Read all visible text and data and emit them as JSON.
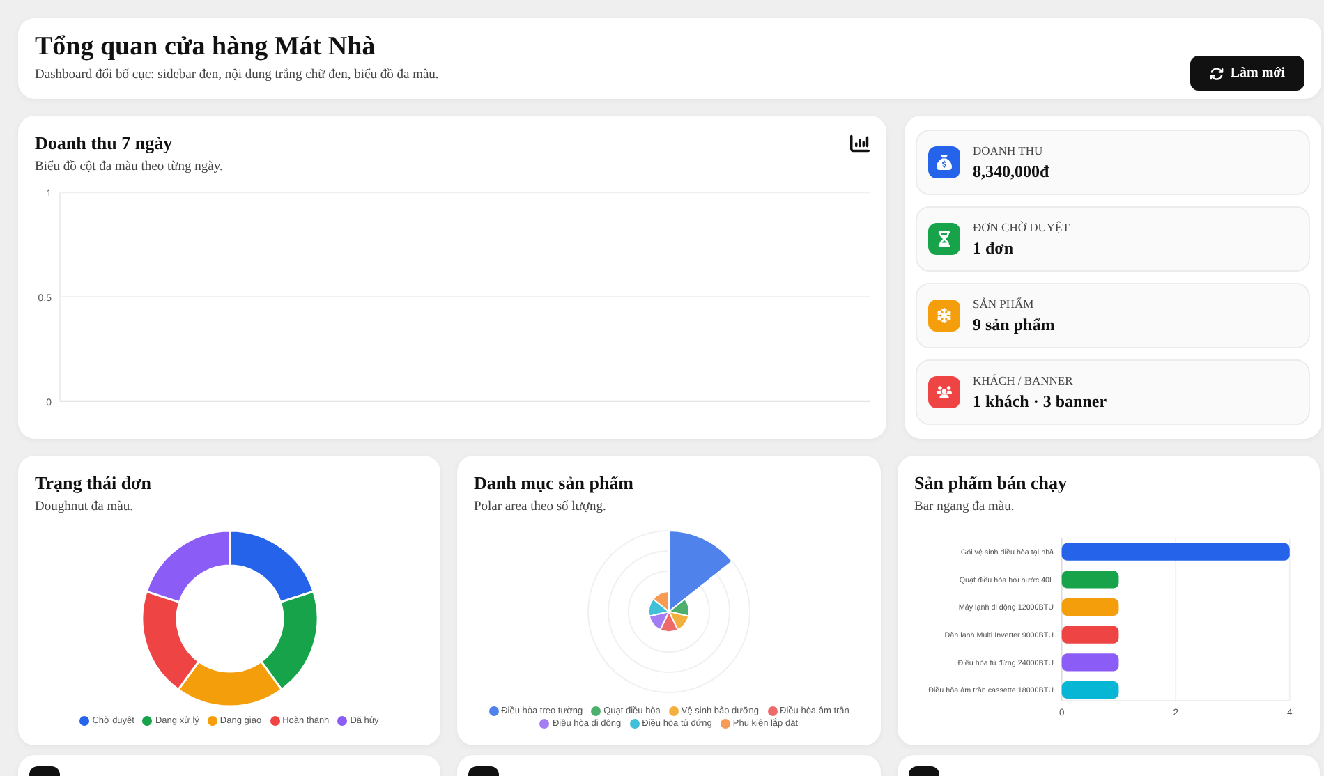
{
  "header": {
    "title": "Tổng quan cửa hàng Mát Nhà",
    "subtitle": "Dashboard đổi bố cục: sidebar đen, nội dung trắng chữ đen, biểu đồ đa màu.",
    "refresh_button": "Làm mới"
  },
  "revenue": {
    "title": "Doanh thu 7 ngày",
    "subtitle": "Biểu đồ cột đa màu theo từng ngày.",
    "axis_labels": [
      "1",
      "0.5",
      "0"
    ]
  },
  "stats": [
    {
      "label": "DOANH THU",
      "value": "8,340,000đ",
      "color": "#2563eb"
    },
    {
      "label": "ĐƠN CHỜ DUYỆT",
      "value": "1 đơn",
      "color": "#16a34a"
    },
    {
      "label": "SẢN PHẨM",
      "value": "9 sản phẩm",
      "color": "#f59e0b"
    },
    {
      "label": "KHÁCH / BANNER",
      "value": "1 khách · 3 banner",
      "color": "#ef4444"
    }
  ],
  "order_status": {
    "title": "Trạng thái đơn",
    "subtitle": "Doughnut đa màu.",
    "legend": [
      {
        "label": "Chờ duyệt",
        "color": "#2563eb"
      },
      {
        "label": "Đang xử lý",
        "color": "#16a34a"
      },
      {
        "label": "Đang giao",
        "color": "#f59e0b"
      },
      {
        "label": "Hoàn thành",
        "color": "#ef4444"
      },
      {
        "label": "Đã hủy",
        "color": "#8b5cf6"
      }
    ]
  },
  "categories": {
    "title": "Danh mục sản phẩm",
    "subtitle": "Polar area theo số lượng.",
    "legend": [
      {
        "label": "Điều hòa treo tường",
        "color": "#5082ec"
      },
      {
        "label": "Quạt điều hòa",
        "color": "#4caf6e"
      },
      {
        "label": "Vệ sinh bảo dưỡng",
        "color": "#f4b03f"
      },
      {
        "label": "Điều hòa âm trần",
        "color": "#ee6a6a"
      },
      {
        "label": "Điều hòa di động",
        "color": "#a47df3"
      },
      {
        "label": "Điều hòa tủ đứng",
        "color": "#3fc0d8"
      },
      {
        "label": "Phụ kiện lắp đặt",
        "color": "#f79a54"
      }
    ]
  },
  "best_sellers": {
    "title": "Sản phẩm bán chạy",
    "subtitle": "Bar ngang đa màu.",
    "chart_data": {
      "type": "bar",
      "orientation": "horizontal",
      "categories": [
        "Gói vệ sinh điều hòa tại nhà",
        "Quạt điều hòa hơi nước 40L",
        "Máy lạnh di động 12000BTU",
        "Dàn lạnh Multi Inverter 9000BTU",
        "Điều hòa tủ đứng 24000BTU",
        "Điều hòa âm trần cassette 18000BTU"
      ],
      "values": [
        4,
        1,
        1,
        1,
        1,
        1
      ],
      "colors": [
        "#2563eb",
        "#16a34a",
        "#f59e0b",
        "#ef4444",
        "#8b5cf6",
        "#06b6d4"
      ],
      "xlim": [
        0,
        4
      ],
      "xticks": [
        0,
        2,
        4
      ]
    }
  }
}
